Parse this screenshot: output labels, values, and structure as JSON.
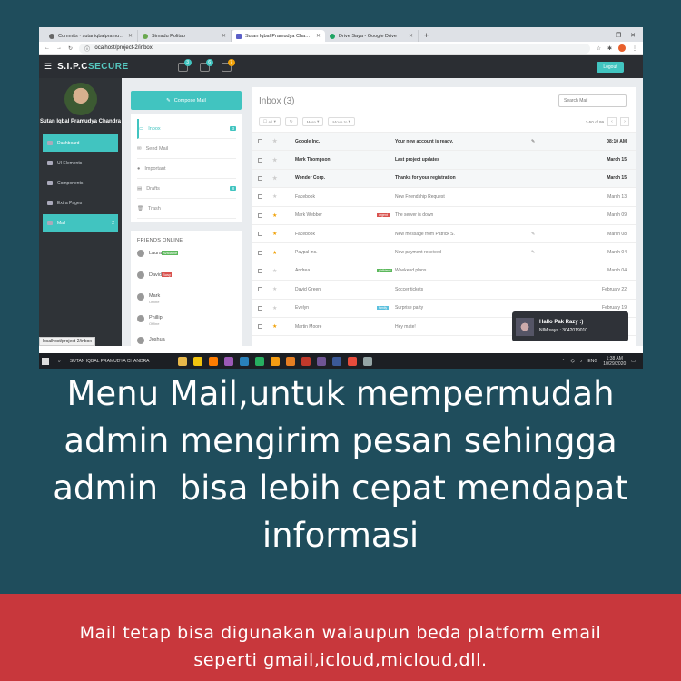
{
  "browser": {
    "tabs": [
      {
        "title": "Commits · sutaniqbalpramudya...",
        "active": false
      },
      {
        "title": "Simadu Politap",
        "active": false
      },
      {
        "title": "Sutan Iqbal Pramudya Chandra | ...",
        "active": true
      },
      {
        "title": "Drive Saya - Google Drive",
        "active": false
      }
    ],
    "url": "localhost/project-2/inbox"
  },
  "app": {
    "brand_prefix": "S.I.P.C",
    "brand_suffix": "SECURE",
    "header_badges": [
      "3",
      "6",
      "7"
    ],
    "logout_label": "Logout"
  },
  "sidebar": {
    "user_name": "Sutan Iqbal Pramudya Chandra",
    "items": [
      {
        "label": "Dashboard",
        "active": true,
        "badge": ""
      },
      {
        "label": "UI Elements",
        "active": false,
        "badge": ""
      },
      {
        "label": "Components",
        "active": false,
        "badge": ""
      },
      {
        "label": "Extra Pages",
        "active": false,
        "badge": ""
      },
      {
        "label": "Mail",
        "active": true,
        "badge": "2"
      }
    ],
    "status_url": "localhost/project-2/inbox"
  },
  "mail": {
    "compose_label": "Compose Mail",
    "folders": [
      {
        "label": "Inbox",
        "badge": "3",
        "active": true
      },
      {
        "label": "Send Mail",
        "badge": "",
        "active": false
      },
      {
        "label": "Important",
        "badge": "",
        "active": false
      },
      {
        "label": "Drafts",
        "badge": "8",
        "active": false
      },
      {
        "label": "Trash",
        "badge": "",
        "active": false
      }
    ],
    "friends_heading": "FRIENDS ONLINE",
    "friends": [
      {
        "name": "Laura",
        "status": "Available",
        "kind": "green"
      },
      {
        "name": "David",
        "status": "Busy",
        "kind": "red"
      },
      {
        "name": "Mark",
        "status": "Offline",
        "kind": "grey"
      },
      {
        "name": "Phillip",
        "status": "Offline",
        "kind": "grey"
      },
      {
        "name": "Joshua",
        "status": "",
        "kind": "grey"
      }
    ],
    "inbox_title": "Inbox (3)",
    "search_placeholder": "Search Mail",
    "toolbar": {
      "all": "All",
      "more": "More",
      "move_to": "Move to"
    },
    "pager_text": "1-50 of 99",
    "messages": [
      {
        "sender": "Google Inc.",
        "label": "",
        "label_color": "",
        "subject": "Your new account is ready.",
        "attach": true,
        "date": "08:10 AM",
        "starred": false,
        "unread": true
      },
      {
        "sender": "Mark Thompson",
        "label": "",
        "label_color": "",
        "subject": "Last project updates",
        "attach": false,
        "date": "March 15",
        "starred": false,
        "unread": true
      },
      {
        "sender": "Wonder Corp.",
        "label": "",
        "label_color": "",
        "subject": "Thanks for your registration",
        "attach": false,
        "date": "March 15",
        "starred": false,
        "unread": true
      },
      {
        "sender": "Facebook",
        "label": "",
        "label_color": "",
        "subject": "New Friendship Request",
        "attach": false,
        "date": "March 13",
        "starred": false,
        "unread": false
      },
      {
        "sender": "Mark Webber",
        "label": "urgent",
        "label_color": "#d9534f",
        "subject": "The server is down",
        "attach": false,
        "date": "March 09",
        "starred": true,
        "unread": false
      },
      {
        "sender": "Facebook",
        "label": "",
        "label_color": "",
        "subject": "New message from Patrick S.",
        "attach": true,
        "date": "March 08",
        "starred": true,
        "unread": false
      },
      {
        "sender": "Paypal inc.",
        "label": "",
        "label_color": "",
        "subject": "New payment received",
        "attach": true,
        "date": "March 04",
        "starred": true,
        "unread": false
      },
      {
        "sender": "Andrea",
        "label": "girlfriend",
        "label_color": "#5cb85c",
        "subject": "Weekend plans",
        "attach": false,
        "date": "March 04",
        "starred": false,
        "unread": false
      },
      {
        "sender": "David Green",
        "label": "",
        "label_color": "",
        "subject": "Soccer tickets",
        "attach": false,
        "date": "February 22",
        "starred": false,
        "unread": false
      },
      {
        "sender": "Evelyn",
        "label": "family",
        "label_color": "#5bc0de",
        "subject": "Surprise party",
        "attach": false,
        "date": "February 19",
        "starred": false,
        "unread": false
      },
      {
        "sender": "Martin Moore",
        "label": "",
        "label_color": "",
        "subject": "Hey mate!",
        "attach": false,
        "date": "February 17",
        "starred": true,
        "unread": false
      }
    ]
  },
  "notification": {
    "title": "Hallo Pak Razy :)",
    "body": "NIM saya : 3042019010"
  },
  "taskbar": {
    "pinned_title": "SUTAN IQBAL PRAMUDYA CHANDRA",
    "lang": "ENG",
    "time": "1:38 AM",
    "date": "10/29/2020",
    "icon_colors": [
      "#e8b84a",
      "#f1c40f",
      "#ff7c00",
      "#9b59b6",
      "#2980b9",
      "#27ae60",
      "#f39c12",
      "#e67e22",
      "#c0392b",
      "#6e5494",
      "#3b5998",
      "#e74c3c",
      "#95a5a6"
    ]
  },
  "caption_lines": [
    "Menu Mail,untuk mempermudah",
    "admin mengirim pesan sehingga",
    "admin  bisa lebih cepat mendapat",
    "informasi"
  ],
  "banner_lines": [
    "Mail tetap bisa digunakan walaupun beda platform email",
    "seperti gmail,icloud,micloud,dll."
  ]
}
